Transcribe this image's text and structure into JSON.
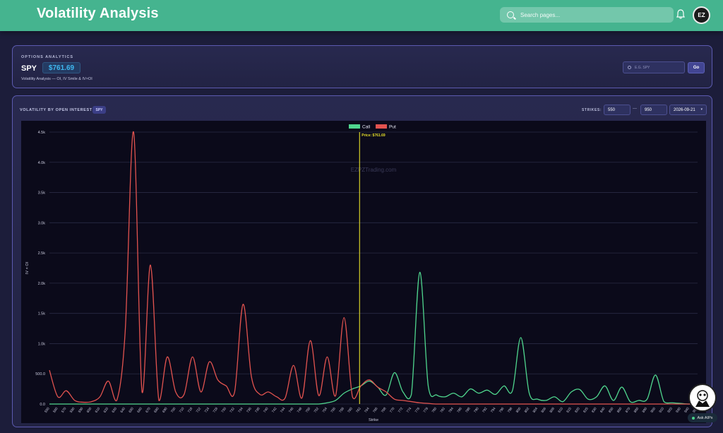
{
  "header": {
    "title": "Volatility Analysis",
    "search_placeholder": "Search pages...",
    "avatar_text": "EZ"
  },
  "summary": {
    "eyebrow": "OPTIONS ANALYTICS",
    "ticker": "SPY",
    "price": "$761.69",
    "subtitle": "Volatility Analysis — OI, IV Smile & IV×OI",
    "input_placeholder": "E.G. SPY",
    "go_label": "Go"
  },
  "chart_panel": {
    "title": "VOLATILITY BY OPEN INTEREST",
    "badge": "SPY",
    "strikes_label": "STRIKES:",
    "strike_min": "550",
    "dash": "—",
    "strike_max": "950",
    "expiry": "2026-09-21"
  },
  "ask_ai": {
    "label": "Ask AIPx"
  },
  "colors": {
    "call": "#4fd68e",
    "put": "#e2534f",
    "price_line": "#e6df2a",
    "accent": "#45b48f"
  },
  "chart_data": {
    "type": "line",
    "watermark": "EZPZTrading.com",
    "xlabel": "Strike",
    "ylabel": "IV × OI",
    "ylim": [
      0,
      4500
    ],
    "y_ticks": [
      "0.0",
      "500.0",
      "1.0k",
      "1.5k",
      "2.0k",
      "2.5k",
      "3.0k",
      "3.5k",
      "4.0k",
      "4.5k"
    ],
    "price_marker": {
      "value": 761.69,
      "label": "Price: $761.69"
    },
    "x_ticks": [
      "550",
      "560",
      "570",
      "580",
      "590",
      "600",
      "610",
      "620",
      "630",
      "640",
      "650",
      "660",
      "670",
      "680",
      "690",
      "700",
      "710",
      "718",
      "722",
      "724",
      "728",
      "730",
      "732",
      "734",
      "736",
      "738",
      "740",
      "742",
      "744",
      "746",
      "748",
      "750",
      "752",
      "754",
      "756",
      "758",
      "760",
      "762",
      "764",
      "766",
      "768",
      "770",
      "772",
      "774",
      "776",
      "778",
      "780",
      "782",
      "784",
      "786",
      "788",
      "790",
      "792",
      "794",
      "796",
      "798",
      "800",
      "802",
      "804",
      "806",
      "808",
      "810",
      "815",
      "820",
      "825",
      "830",
      "840",
      "850",
      "860",
      "870",
      "880",
      "890",
      "900",
      "910",
      "920",
      "930",
      "940",
      "950"
    ],
    "legend": [
      "Call",
      "Put"
    ],
    "series": [
      {
        "name": "Call",
        "values": [
          0,
          0,
          0,
          0,
          0,
          0,
          0,
          0,
          0,
          0,
          0,
          0,
          0,
          0,
          0,
          0,
          0,
          0,
          0,
          0,
          0,
          0,
          0,
          0,
          0,
          0,
          0,
          0,
          0,
          0,
          0,
          0,
          0,
          20,
          60,
          180,
          250,
          300,
          380,
          280,
          150,
          520,
          200,
          160,
          2180,
          300,
          150,
          120,
          180,
          120,
          250,
          180,
          230,
          160,
          300,
          220,
          1100,
          180,
          80,
          60,
          120,
          40,
          200,
          240,
          80,
          120,
          300,
          60,
          280,
          40,
          60,
          80,
          480,
          40,
          20,
          10,
          0,
          0
        ]
      },
      {
        "name": "Put",
        "values": [
          560,
          120,
          220,
          60,
          30,
          40,
          120,
          380,
          60,
          1200,
          4500,
          200,
          2300,
          60,
          780,
          200,
          160,
          780,
          200,
          700,
          400,
          300,
          200,
          1650,
          450,
          160,
          200,
          120,
          100,
          640,
          100,
          1050,
          140,
          780,
          140,
          1430,
          120,
          300,
          400,
          280,
          200,
          80,
          60,
          40,
          20,
          10,
          0,
          0,
          0,
          0,
          0,
          0,
          0,
          0,
          0,
          0,
          0,
          0,
          0,
          0,
          0,
          0,
          0,
          0,
          0,
          0,
          0,
          0,
          0,
          0,
          0,
          0,
          0,
          0,
          0,
          0,
          0,
          0
        ]
      }
    ]
  }
}
